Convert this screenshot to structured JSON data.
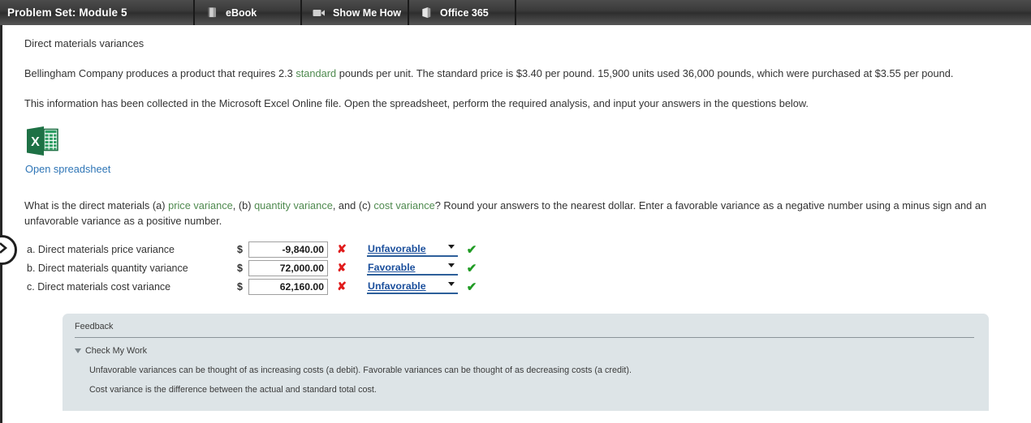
{
  "topbar": {
    "title": "Problem Set: Module 5",
    "tabs": [
      {
        "label": "eBook",
        "icon": "book-icon"
      },
      {
        "label": "Show Me How",
        "icon": "video-camera-icon"
      },
      {
        "label": "Office 365",
        "icon": "office-365-icon"
      }
    ]
  },
  "content": {
    "heading": "Direct materials variances",
    "problem": {
      "part1": "Bellingham Company produces a product that requires 2.3 ",
      "glossary_standard": "standard",
      "part2": " pounds per unit. The standard price is $3.40 per pound. 15,900 units used 36,000 pounds, which were purchased at $3.55 per pound."
    },
    "instruction": "This information has been collected in the Microsoft Excel Online file. Open the spreadsheet, perform the required analysis, and input your answers in the questions below.",
    "spreadsheet": {
      "icon": "excel-icon",
      "link_label": "Open spreadsheet"
    },
    "question": {
      "part1": "What is the direct materials (a) ",
      "link_price": "price variance",
      "part2": ", (b) ",
      "link_quantity": "quantity variance",
      "part3": ", and (c) ",
      "link_cost": "cost variance",
      "part4": "? Round your answers to the nearest dollar. Enter a favorable variance as a negative number using a minus sign and an unfavorable variance as a positive number."
    },
    "answers": [
      {
        "label": "a. Direct materials price variance",
        "currency": "$",
        "value": "-9,840.00",
        "value_mark": "✘",
        "value_mark_state": "wrong",
        "select_value": "Unfavorable",
        "select_mark": "✔",
        "select_mark_state": "right"
      },
      {
        "label": "b. Direct materials quantity variance",
        "currency": "$",
        "value": "72,000.00",
        "value_mark": "✘",
        "value_mark_state": "wrong",
        "select_value": "Favorable",
        "select_mark": "✔",
        "select_mark_state": "right"
      },
      {
        "label": "c. Direct materials cost variance",
        "currency": "$",
        "value": "62,160.00",
        "value_mark": "✘",
        "value_mark_state": "wrong",
        "select_value": "Unfavorable",
        "select_mark": "✔",
        "select_mark_state": "right"
      }
    ],
    "feedback": {
      "title": "Feedback",
      "check_my_work": "Check My Work",
      "lines": [
        "Unfavorable variances can be thought of as increasing costs (a debit). Favorable variances can be thought of as decreasing costs (a credit).",
        "Cost variance is the difference between the actual and standard total cost."
      ]
    },
    "left_nav": {
      "icon": "chevron-right-icon"
    }
  },
  "colors": {
    "glossary_link": "#4f8a4f",
    "spreadsheet_link": "#2e75b6",
    "select_text": "#1b4f9c",
    "wrong_mark": "#e01b1b",
    "right_mark": "#1f9b23",
    "feedback_bg": "#dde4e7",
    "topbar_bg": "#3a3a3a"
  }
}
